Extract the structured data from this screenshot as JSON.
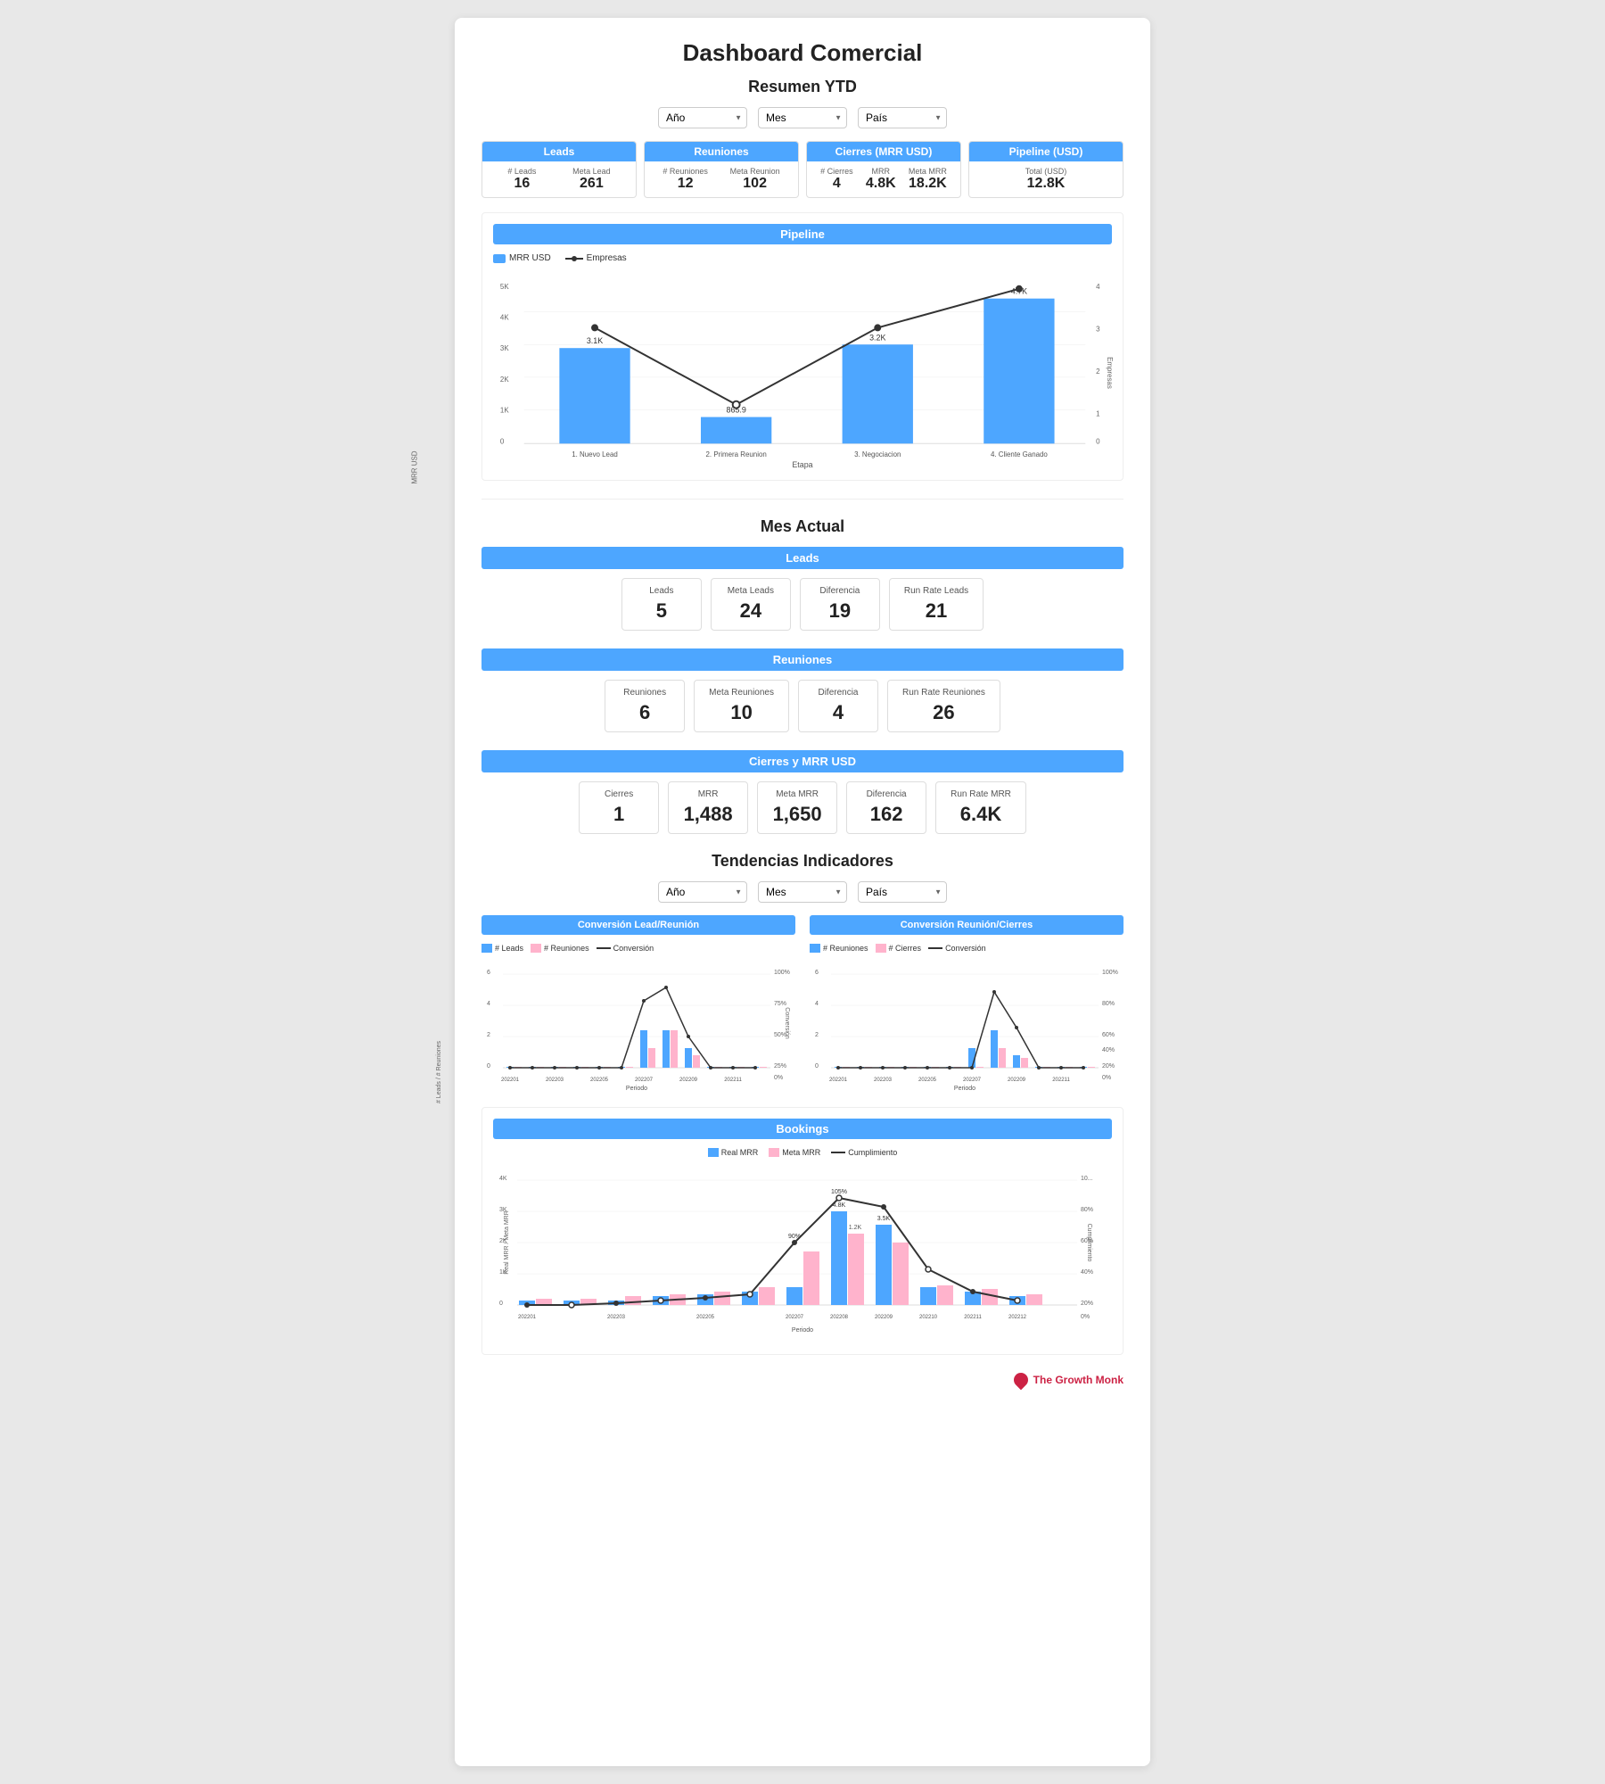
{
  "page": {
    "main_title": "Dashboard Comercial",
    "brand": "The Growth Monk"
  },
  "resumen_ytd": {
    "title": "Resumen YTD",
    "filters": {
      "ano_label": "Año",
      "mes_label": "Mes",
      "pais_label": "País"
    },
    "kpis": [
      {
        "header": "Leads",
        "items": [
          {
            "label": "# Leads",
            "value": "16"
          },
          {
            "label": "Meta Lead",
            "value": "261"
          }
        ]
      },
      {
        "header": "Reuniones",
        "items": [
          {
            "label": "# Reuniones",
            "value": "12"
          },
          {
            "label": "Meta Reunion",
            "value": "102"
          }
        ]
      },
      {
        "header": "Cierres (MRR USD)",
        "items": [
          {
            "label": "# Cierres",
            "value": "4"
          },
          {
            "label": "MRR",
            "value": "4.8K"
          },
          {
            "label": "Meta MRR",
            "value": "18.2K"
          }
        ]
      },
      {
        "header": "Pipeline (USD)",
        "items": [
          {
            "label": "Total (USD)",
            "value": "12.8K"
          }
        ]
      }
    ],
    "pipeline": {
      "chart_title": "Pipeline",
      "legend_mrr": "MRR USD",
      "legend_empresas": "Empresas",
      "stages": [
        "1. Nuevo Lead",
        "2. Primera Reunion",
        "3. Negociacion",
        "4. Cliente Ganado"
      ],
      "mrr_values": [
        3100,
        865,
        3200,
        4700
      ],
      "empresa_values": [
        3,
        1,
        3,
        4
      ]
    }
  },
  "mes_actual": {
    "title": "Mes Actual",
    "leads": {
      "header": "Leads",
      "cards": [
        {
          "label": "Leads",
          "value": "5"
        },
        {
          "label": "Meta Leads",
          "value": "24"
        },
        {
          "label": "Diferencia",
          "value": "19"
        },
        {
          "label": "Run Rate Leads",
          "value": "21"
        }
      ]
    },
    "reuniones": {
      "header": "Reuniones",
      "cards": [
        {
          "label": "Reuniones",
          "value": "6"
        },
        {
          "label": "Meta Reuniones",
          "value": "10"
        },
        {
          "label": "Diferencia",
          "value": "4"
        },
        {
          "label": "Run Rate Reuniones",
          "value": "26"
        }
      ]
    },
    "cierres": {
      "header": "Cierres y MRR USD",
      "cards": [
        {
          "label": "Cierres",
          "value": "1"
        },
        {
          "label": "MRR",
          "value": "1,488"
        },
        {
          "label": "Meta MRR",
          "value": "1,650"
        },
        {
          "label": "Diferencia",
          "value": "162"
        },
        {
          "label": "Run Rate MRR",
          "value": "6.4K"
        }
      ]
    }
  },
  "tendencias": {
    "title": "Tendencias Indicadores",
    "filters": {
      "ano_label": "Año",
      "mes_label": "Mes",
      "pais_label": "País"
    },
    "conv_lead_reunion": {
      "header": "Conversión Lead/Reunión",
      "legend_leads": "# Leads",
      "legend_reuniones": "# Reuniones",
      "legend_conversion": "Conversión"
    },
    "conv_reunion_cierres": {
      "header": "Conversión Reunión/Cierres",
      "legend_reuniones": "# Reuniones",
      "legend_cierres": "# Cierres",
      "legend_conversion": "Conversión"
    },
    "bookings": {
      "header": "Bookings",
      "legend_real": "Real MRR",
      "legend_meta": "Meta MRR",
      "legend_cumplimiento": "Cumplimiento"
    }
  }
}
